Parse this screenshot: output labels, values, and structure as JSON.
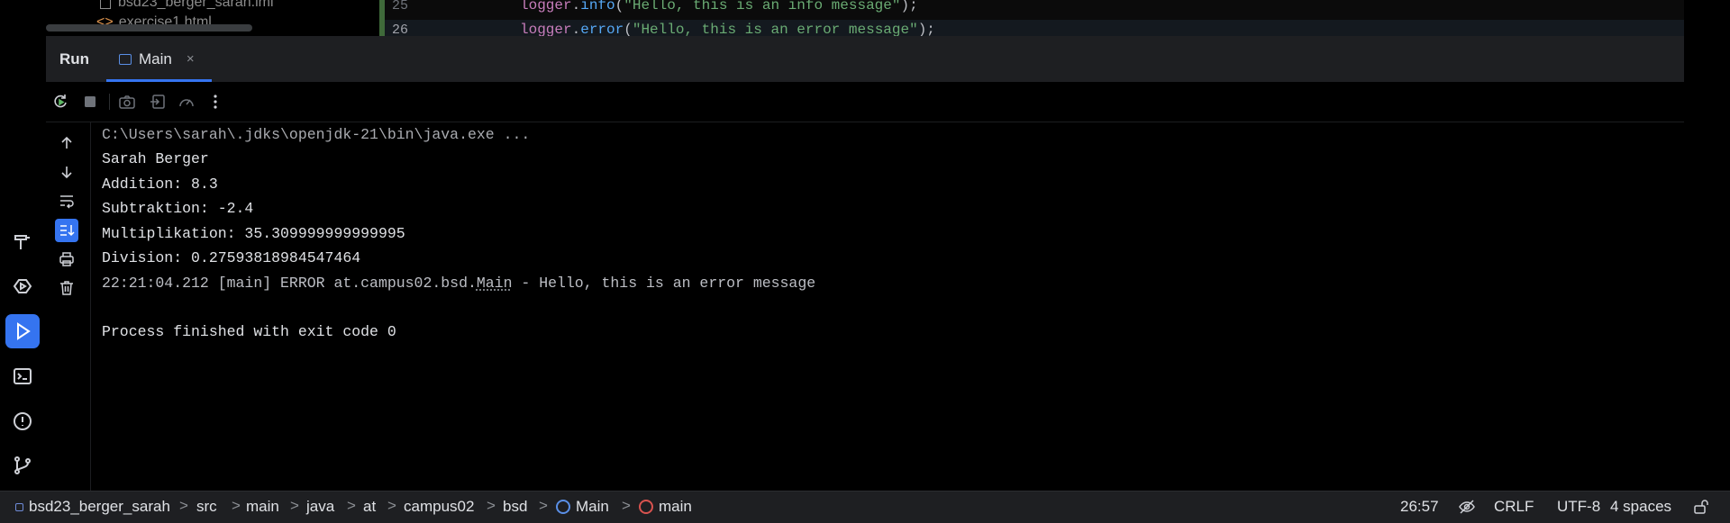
{
  "editor": {
    "project_lines": [
      "bsd23_berger_sarah.iml",
      "exercise1.html"
    ],
    "line_numbers": [
      "25",
      "26"
    ],
    "code_lines": [
      {
        "obj": "logger",
        "dot": ".",
        "method": "info",
        "open": "(",
        "str": "\"Hello, this is an info message\"",
        "close": ");"
      },
      {
        "obj": "logger",
        "dot": ".",
        "method": "error",
        "open": "(",
        "str": "\"Hello, this is an error message\"",
        "close": ");"
      }
    ]
  },
  "run_window": {
    "title": "Run",
    "tab": {
      "label": "Main",
      "close": "×"
    },
    "toolbar": [
      "rerun-icon",
      "stop-icon",
      "camera-icon",
      "exit-icon",
      "gauge-icon",
      "more-vertical-icon"
    ],
    "side_actions": [
      "arrow-up-icon",
      "arrow-down-icon",
      "soft-wrap-icon",
      "scroll-to-end-icon",
      "print-icon",
      "trash-icon"
    ]
  },
  "console": {
    "lines": [
      "C:\\Users\\sarah\\.jdks\\openjdk-21\\bin\\java.exe ...",
      "Sarah Berger",
      "Addition: 8.3",
      "Subtraktion: -2.4",
      "Multiplikation: 35.309999999999995",
      "Division: 0.27593818984547464"
    ],
    "error_prefix": "22:21:04.212 [main] ERROR at.campus02.bsd.",
    "error_link": "Main",
    "error_suffix": " - Hello, this is an error message",
    "finish": "Process finished with exit code 0"
  },
  "status_bar": {
    "breadcrumbs": [
      "bsd23_berger_sarah",
      "src",
      "main",
      "java",
      "at",
      "campus02",
      "bsd",
      "Main",
      "main"
    ],
    "separator": ">",
    "position": "26:57",
    "line_ending": "CRLF",
    "encoding": "UTF-8",
    "indent": "4 spaces"
  },
  "left_toolbar": [
    "build-icon",
    "services-icon",
    "run-icon",
    "terminal-icon",
    "problems-icon",
    "git-icon"
  ],
  "colors": {
    "accent": "#3574f0",
    "background": "#000000",
    "status_bg": "#1e1f22"
  }
}
